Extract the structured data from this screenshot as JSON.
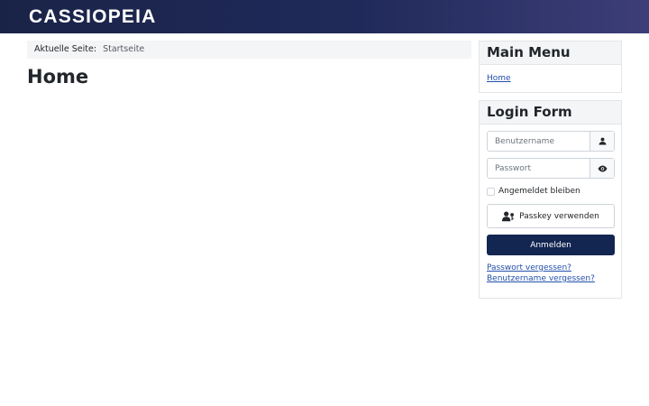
{
  "header": {
    "brand": "CASSIOPEIA"
  },
  "breadcrumb": {
    "label": "Aktuelle Seite:",
    "current": "Startseite"
  },
  "main": {
    "title": "Home"
  },
  "main_menu": {
    "title": "Main Menu",
    "items": [
      {
        "label": "Home"
      }
    ]
  },
  "login": {
    "title": "Login Form",
    "username_placeholder": "Benutzername",
    "password_placeholder": "Passwort",
    "username_icon": "user-icon",
    "password_icon": "eye-icon",
    "remember_label": "Angemeldet bleiben",
    "passkey_label": "Passkey verwenden",
    "passkey_icon": "user-key-icon",
    "submit_label": "Anmelden",
    "forgot_password": "Passwort vergessen?",
    "forgot_username": "Benutzername vergessen?"
  },
  "colors": {
    "header_start": "#1a2347",
    "header_end": "#3d3e78",
    "button": "#132551",
    "link": "#224faa"
  }
}
